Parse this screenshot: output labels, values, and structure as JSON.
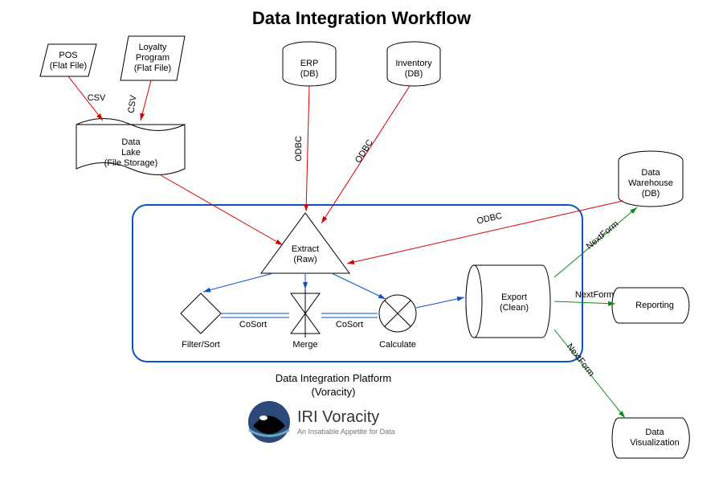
{
  "title": "Data Integration Workflow",
  "nodes": {
    "pos": {
      "l1": "POS",
      "l2": "(Flat File)"
    },
    "loyalty": {
      "l1": "Loyalty",
      "l2": "Program",
      "l3": "(Flat File)"
    },
    "erp": {
      "l1": "ERP",
      "l2": "(DB)"
    },
    "inventory": {
      "l1": "Inventory",
      "l2": "(DB)"
    },
    "lake": {
      "l1": "Data",
      "l2": "Lake",
      "l3": "(File Storage)"
    },
    "extract": {
      "l1": "Extract",
      "l2": "(Raw)"
    },
    "filter": {
      "caption": "Filter/Sort"
    },
    "merge": {
      "caption": "Merge"
    },
    "calc": {
      "caption": "Calculate"
    },
    "export": {
      "l1": "Export",
      "l2": "(Clean)"
    },
    "dw": {
      "l1": "Data",
      "l2": "Warehouse",
      "l3": "(DB)"
    },
    "report": {
      "l1": "Reporting"
    },
    "viz": {
      "l1": "Data",
      "l2": "Visualization"
    }
  },
  "edges": {
    "pos_lake": "CSV",
    "loy_lake": "CSV",
    "erp_ext": "ODBC",
    "inv_ext": "ODBC",
    "dw_ext": "ODBC",
    "fil_mer": "CoSort",
    "mer_cal": "CoSort",
    "exp_dw": "NextForm",
    "exp_rep": "NextForm",
    "exp_viz": "NextForm"
  },
  "platform": {
    "l1": "Data Integration Platform",
    "l2": "(Voracity)"
  },
  "logo": {
    "main": "IRI Voracity",
    "sub": "An Insatiable Appetite for Data"
  }
}
